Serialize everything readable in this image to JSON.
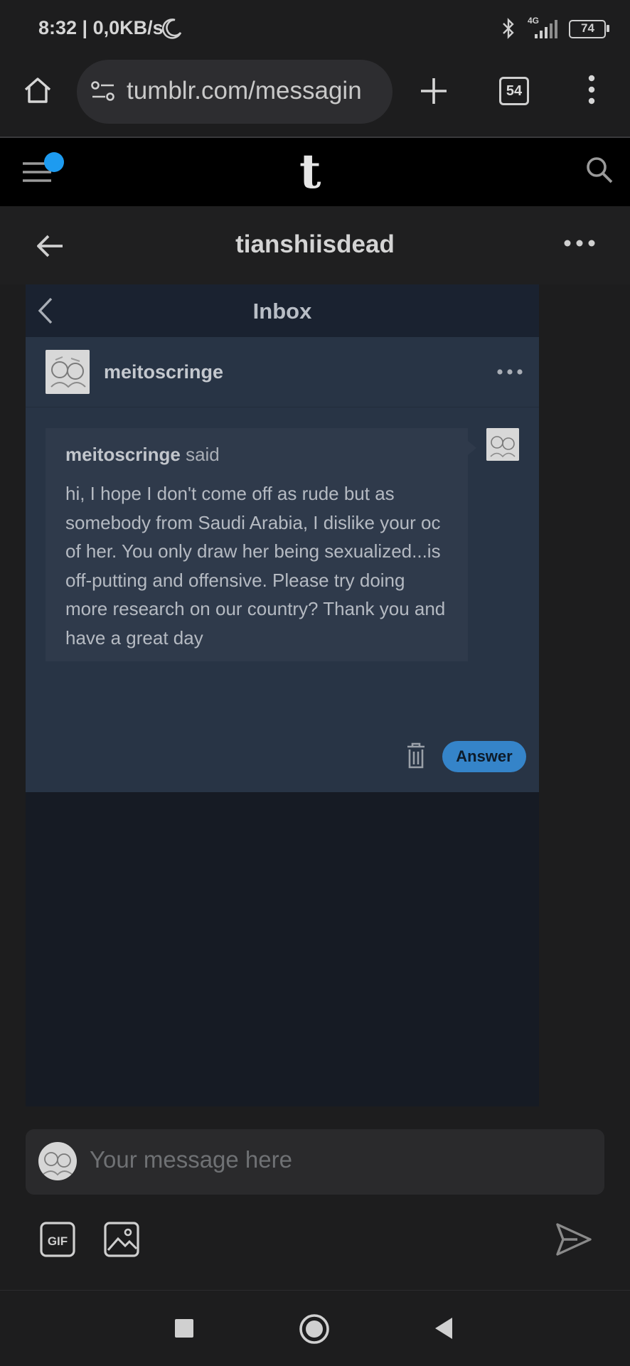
{
  "status_bar": {
    "time": "8:32 | 0,0KB/s",
    "network_label": "4G",
    "battery": "74",
    "icons": [
      "moon-icon",
      "bluetooth-icon",
      "signal-icon",
      "battery-icon"
    ]
  },
  "browser": {
    "url": "tumblr.com/messagin",
    "tab_count": "54",
    "icons": [
      "home-icon",
      "site-settings-icon",
      "new-tab-icon",
      "tabs-icon",
      "more-vertical-icon"
    ]
  },
  "tumblr_header": {
    "logo": "t",
    "notification_dot_color": "#1d9bf0",
    "icons": [
      "menu-icon",
      "search-icon"
    ]
  },
  "conversation": {
    "title": "tianshiisdead",
    "icons": [
      "back-arrow-icon",
      "more-horizontal-icon"
    ]
  },
  "inbox": {
    "title": "Inbox",
    "ask": {
      "asker": "meitoscringe",
      "said_name": "meitoscringe",
      "said_word": "said",
      "message": "hi, I hope I don't come off as rude but as somebody from Saudi Arabia, I dislike your oc of her. You only draw her being sexualized...is off-putting and offensive. Please try doing more research on our country? Thank you and have a great day",
      "answer_label": "Answer"
    },
    "accent_color": "#3584c9"
  },
  "composer": {
    "placeholder": "Your message here",
    "icons": [
      "gif-icon",
      "image-icon",
      "send-icon"
    ]
  },
  "nav_bar": {
    "icons": [
      "recents-icon",
      "home-circle-icon",
      "back-triangle-icon"
    ]
  }
}
